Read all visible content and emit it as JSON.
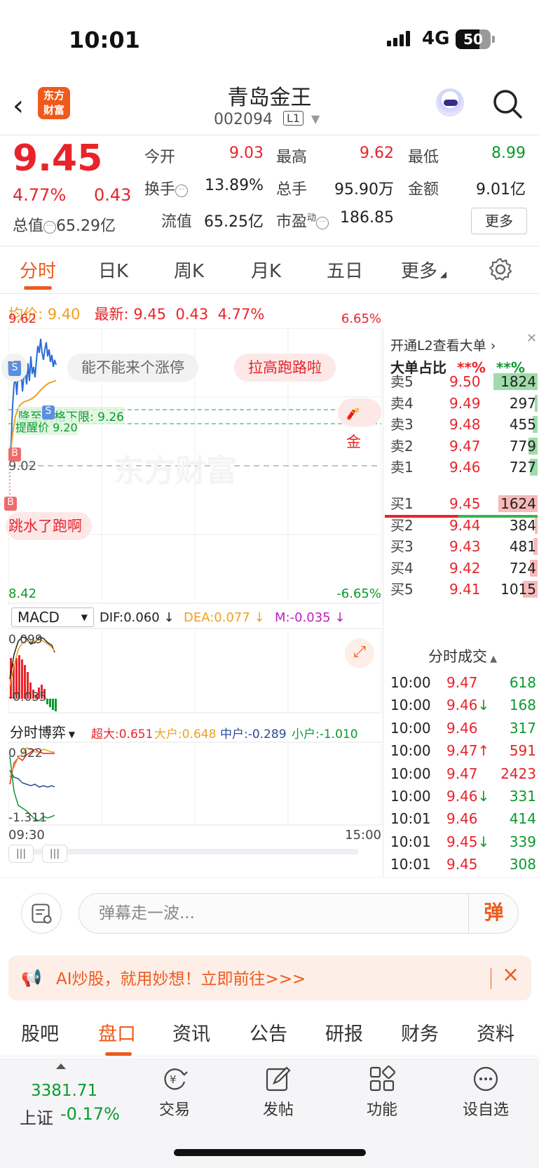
{
  "status": {
    "time": "10:01",
    "network": "4G",
    "battery": "50"
  },
  "header": {
    "title": "青岛金王",
    "code": "002094",
    "level": "L1",
    "logo_text_1": "东方",
    "logo_text_2": "财富"
  },
  "quote": {
    "price": "9.45",
    "pct": "4.77%",
    "change": "0.43",
    "open_label": "今开",
    "open": "9.03",
    "high_label": "最高",
    "high": "9.62",
    "low_label": "最低",
    "low": "8.99",
    "turnover_label": "换手",
    "turnover": "13.89%",
    "volume_label": "总手",
    "volume": "95.90万",
    "amount_label": "金额",
    "amount": "9.01亿",
    "totalcap_label": "总值",
    "totalcap": "65.29亿",
    "floatcap_label": "流值",
    "floatcap": "65.25亿",
    "pe_label": "市盈",
    "pe_sup": "动",
    "pe": "186.85",
    "more_button": "更多"
  },
  "period_tabs": [
    "分时",
    "日K",
    "周K",
    "月K",
    "五日",
    "更多"
  ],
  "avg_row": {
    "avg_label": "均价:",
    "avg_value": "9.40",
    "last_label": "最新:",
    "last_value": "9.45",
    "last_change": "0.43",
    "last_pct": "4.77%"
  },
  "chart": {
    "y_high": "9.62",
    "y_low": "8.42",
    "y_mid": "9.02",
    "pct_high": "6.65%",
    "pct_low": "-6.65%",
    "line1_label": "降至价格下限: 9.26",
    "line2_label": "提醒价 9.20",
    "danmu": [
      "吧",
      "能不能来个涨停",
      "拉高跑路啦",
      "跳水了跑啊",
      "金"
    ],
    "watermark": "东方财富",
    "markers": [
      "S",
      "S",
      "B",
      "B"
    ],
    "x_start": "09:30",
    "x_end": "15:00"
  },
  "macd": {
    "selector": "MACD",
    "dif": "DIF:0.060 ↓",
    "dea": "DEA:0.077 ↓",
    "m": "M:-0.035 ↓",
    "top": "0.099",
    "bottom": "-0.035"
  },
  "game": {
    "selector": "分时博弈",
    "super": "超大:0.651",
    "big": "大户:0.648",
    "mid": "中户:-0.289",
    "small": "小户:-1.010",
    "top": "0.922",
    "bottom": "-1.311"
  },
  "order_book": {
    "header": "开通L2查看大单 ›",
    "big_ratio_label": "大单占比",
    "big_ratio_1": "**%",
    "big_ratio_2": "**%",
    "asks": [
      {
        "label": "卖5",
        "price": "9.50",
        "vol": "1824",
        "ratio": 0.9
      },
      {
        "label": "卖4",
        "price": "9.49",
        "vol": "297",
        "ratio": 0.06
      },
      {
        "label": "卖3",
        "price": "9.48",
        "vol": "455",
        "ratio": 0.1
      },
      {
        "label": "卖2",
        "price": "9.47",
        "vol": "779",
        "ratio": 0.18
      },
      {
        "label": "卖1",
        "price": "9.46",
        "vol": "727",
        "ratio": 0.16
      }
    ],
    "bids": [
      {
        "label": "买1",
        "price": "9.45",
        "vol": "1624",
        "ratio": 0.8
      },
      {
        "label": "买2",
        "price": "9.44",
        "vol": "384",
        "ratio": 0.06
      },
      {
        "label": "买3",
        "price": "9.43",
        "vol": "481",
        "ratio": 0.08
      },
      {
        "label": "买4",
        "price": "9.42",
        "vol": "724",
        "ratio": 0.16
      },
      {
        "label": "买5",
        "price": "9.41",
        "vol": "1015",
        "ratio": 0.3
      }
    ],
    "trades_title": "分时成交",
    "trades": [
      {
        "time": "10:00",
        "price": "9.47",
        "dir": "",
        "vol": "618",
        "color": "#0a9a2e"
      },
      {
        "time": "10:00",
        "price": "9.46",
        "dir": "↓",
        "vol": "168",
        "color": "#0a9a2e"
      },
      {
        "time": "10:00",
        "price": "9.46",
        "dir": "",
        "vol": "317",
        "color": "#0a9a2e"
      },
      {
        "time": "10:00",
        "price": "9.47",
        "dir": "↑",
        "vol": "591",
        "color": "#e8242b"
      },
      {
        "time": "10:00",
        "price": "9.47",
        "dir": "",
        "vol": "2423",
        "color": "#e8242b"
      },
      {
        "time": "10:00",
        "price": "9.46",
        "dir": "↓",
        "vol": "331",
        "color": "#0a9a2e"
      },
      {
        "time": "10:01",
        "price": "9.46",
        "dir": "",
        "vol": "414",
        "color": "#0a9a2e"
      },
      {
        "time": "10:01",
        "price": "9.45",
        "dir": "↓",
        "vol": "339",
        "color": "#0a9a2e"
      },
      {
        "time": "10:01",
        "price": "9.45",
        "dir": "",
        "vol": "308",
        "color": "#0a9a2e"
      }
    ]
  },
  "comment": {
    "placeholder": "弹幕走一波...",
    "send": "弹"
  },
  "ad": {
    "text": "AI炒股，就用妙想！立即前往>>>"
  },
  "content_tabs": [
    "股吧",
    "盘口",
    "资讯",
    "公告",
    "研报",
    "财务",
    "资料"
  ],
  "bottom_nav": {
    "index_value": "3381.71",
    "index_name": "上证",
    "index_change": "-0.17%",
    "items": [
      "交易",
      "发帖",
      "功能",
      "设自选"
    ]
  },
  "colors": {
    "up": "#e8242b",
    "down": "#0a9a2e",
    "brand": "#ef5a1c",
    "avg": "#f0a020"
  }
}
